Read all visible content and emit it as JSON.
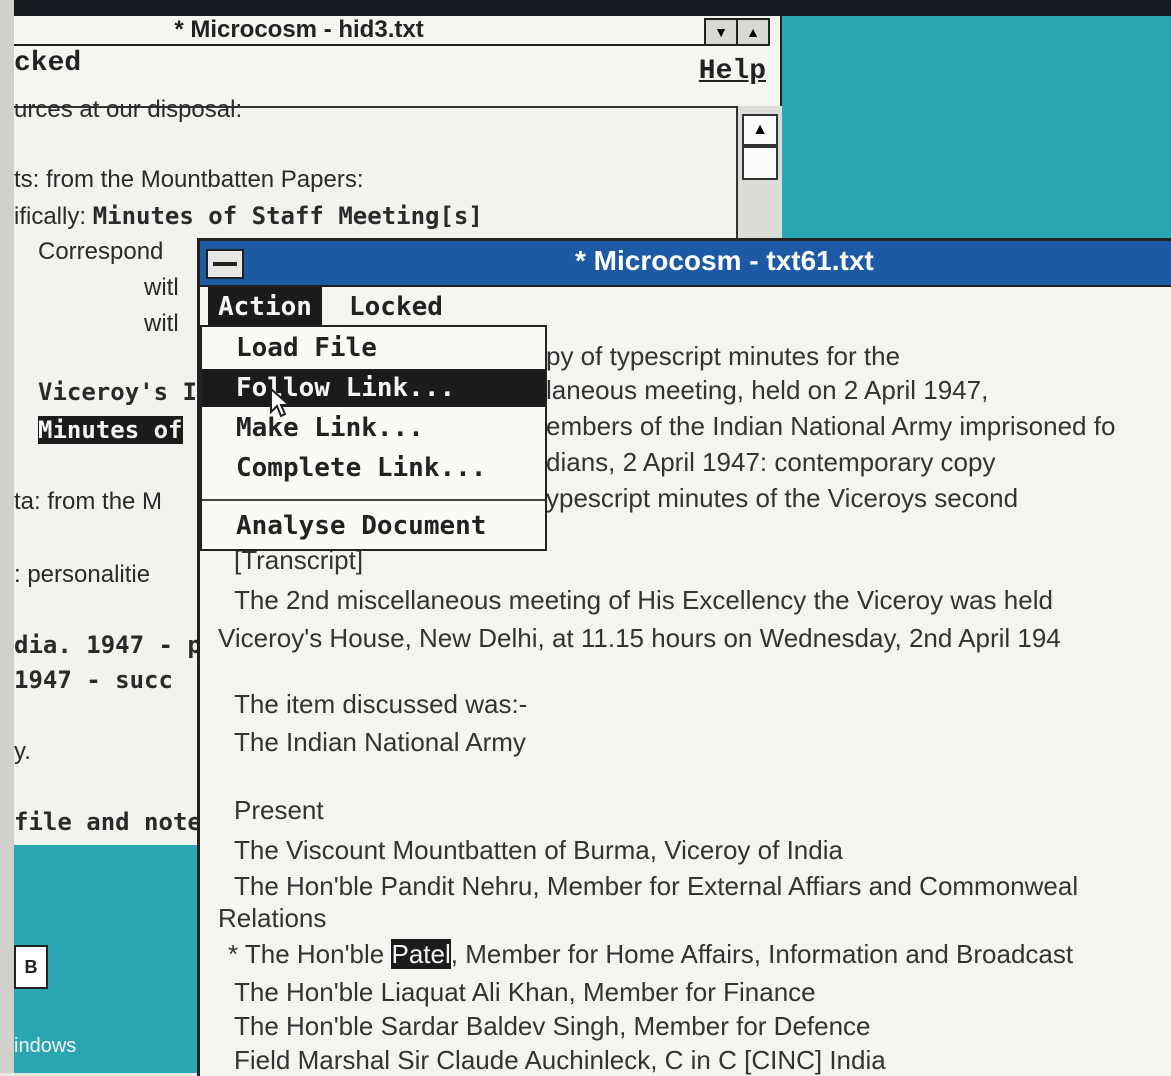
{
  "back_window": {
    "title": "* Microcosm - hid3.txt",
    "menu_left": "cked",
    "menu_help": "Help",
    "lines": [
      {
        "text": "urces at our disposal:",
        "bold": false,
        "highlight": false
      },
      {
        "text": "ts: from the Mountbatten Papers:",
        "bold": false,
        "highlight": false
      },
      {
        "text": "ifically: ",
        "bold": false,
        "highlight": false,
        "bold_tail": "Minutes of Staff Meeting[s]"
      },
      {
        "text": "Correspond",
        "bold": false,
        "highlight": false
      },
      {
        "text": "witl",
        "bold": false,
        "highlight": false
      },
      {
        "text": "witl",
        "bold": false,
        "highlight": false
      },
      {
        "text": "Viceroy's I",
        "bold": true,
        "highlight": false
      },
      {
        "text": "Minutes of",
        "bold": true,
        "highlight": true
      },
      {
        "text": "ta: from the M",
        "bold": false,
        "highlight": false
      },
      {
        "text": ": personalitie",
        "bold": false,
        "highlight": false
      },
      {
        "text": "dia. 1947 - p",
        "bold": true,
        "highlight": false
      },
      {
        "text": "1947 - succ",
        "bold": true,
        "highlight": false
      },
      {
        "text": "y.",
        "bold": false,
        "highlight": false
      },
      {
        "text": "file and note",
        "bold": true,
        "highlight": false
      }
    ]
  },
  "desktop_icon": {
    "glyph": "B",
    "label": "indows"
  },
  "front_window": {
    "title": "* Microcosm - txt61.txt",
    "menus": [
      "Action",
      "Locked"
    ],
    "dropdown": [
      "Load File",
      "Follow Link...",
      "Make Link...",
      "Complete Link...",
      "Analyse Document"
    ],
    "dropdown_active": "Follow Link...",
    "lines": [
      "py of typescript minutes for the",
      "laneous meeting, held on 2 April 1947,",
      "embers of the Indian National Army imprisoned fo",
      "dians, 2 April 1947: contemporary copy",
      "ypescript minutes of the Viceroys second",
      "[Transcript]",
      "The 2nd miscellaneous meeting of His Excellency the Viceroy was held",
      "Viceroy's House, New Delhi, at 11.15 hours on Wednesday, 2nd April 194",
      "The item discussed was:-",
      "The Indian National Army",
      "Present",
      "The Viscount Mountbatten of Burma, Viceroy of India",
      "The Hon'ble Pandit Nehru, Member for External Affiars and Commonweal",
      "Relations",
      "The Hon'ble Liaquat Ali Khan, Member for Finance",
      "The Hon'ble Sardar Baldev Singh, Member for Defence",
      "Field Marshal Sir Claude Auchinleck, C in C [CINC] India"
    ],
    "patel_line": {
      "before": "* The Hon'ble ",
      "selected": "Patel",
      "after": ", Member for Home Affairs, Information and Broadcast"
    }
  }
}
